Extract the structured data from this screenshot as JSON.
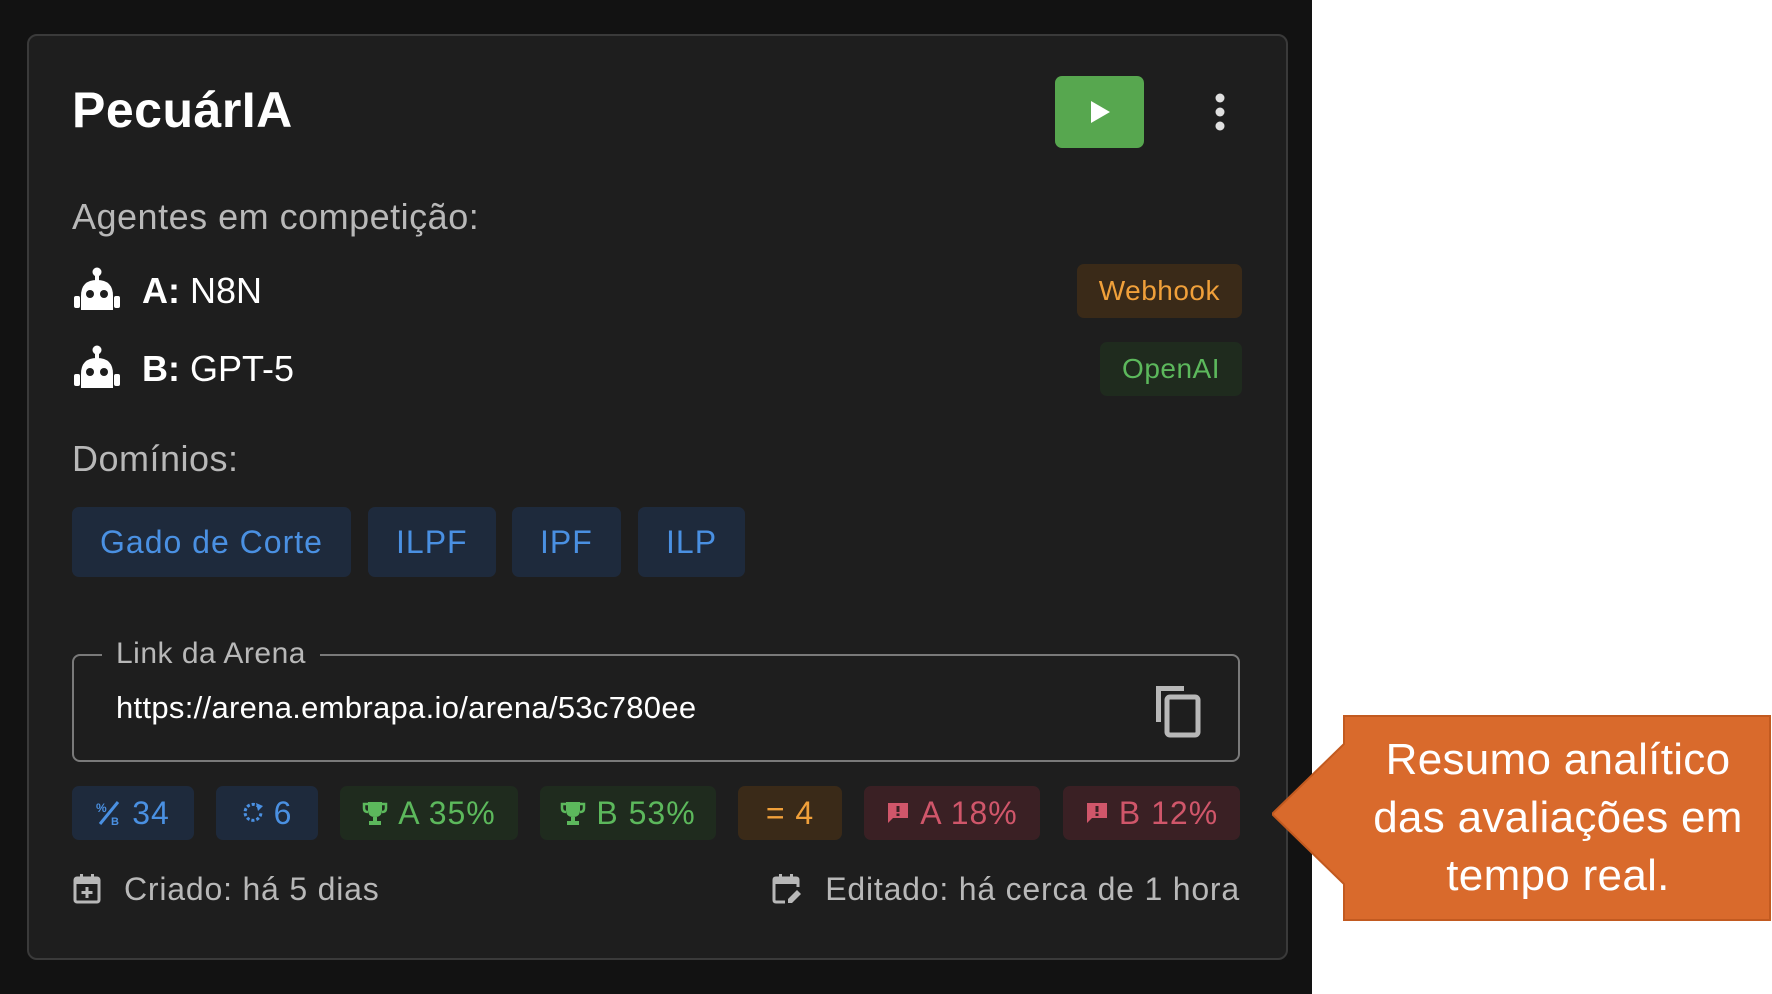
{
  "card": {
    "title": "PecuárIA"
  },
  "agents": {
    "section_label": "Agentes em competição:",
    "items": [
      {
        "key": "A:",
        "name": "N8N",
        "provider": "Webhook"
      },
      {
        "key": "B:",
        "name": "GPT-5",
        "provider": "OpenAI"
      }
    ]
  },
  "domains": {
    "section_label": "Domínios:",
    "items": [
      "Gado de Corte",
      "ILPF",
      "IPF",
      "ILP"
    ]
  },
  "arena_link": {
    "label": "Link da Arena",
    "value": "https://arena.embrapa.io/arena/53c780ee"
  },
  "stats": [
    {
      "icon": "fraction-icon",
      "text": "34",
      "color": "#4a90e2"
    },
    {
      "icon": "refresh-icon",
      "text": "6",
      "color": "#4a90e2"
    },
    {
      "icon": "trophy-icon",
      "text": "A 35%",
      "color": "#5cb85c"
    },
    {
      "icon": "trophy-icon",
      "text": "B 53%",
      "color": "#5cb85c"
    },
    {
      "icon": "equals-icon",
      "text": "= 4",
      "color": "#f0a03a"
    },
    {
      "icon": "alert-icon",
      "text": "A 18%",
      "color": "#d0566a"
    },
    {
      "icon": "alert-icon",
      "text": "B 12%",
      "color": "#d0566a"
    }
  ],
  "meta": {
    "created": "Criado: há 5 dias",
    "edited": "Editado: há cerca de 1 hora"
  },
  "annotation": {
    "text": "Resumo analítico das avaliações em tempo real.",
    "color": "#d96a2c"
  },
  "colors": {
    "play": "#57a74f",
    "card_bg": "#1e1e1e"
  }
}
